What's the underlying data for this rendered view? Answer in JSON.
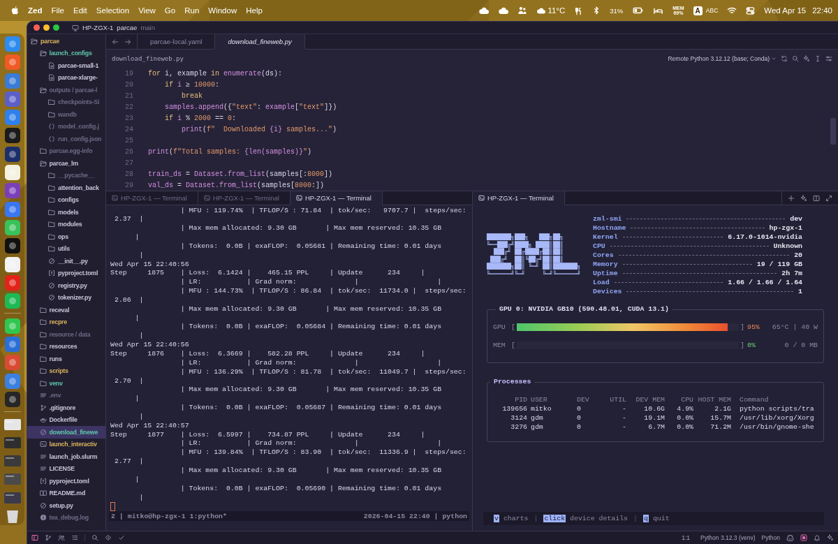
{
  "menubar": {
    "app": "Zed",
    "menus": [
      "File",
      "Edit",
      "Selection",
      "View",
      "Go",
      "Run",
      "Window",
      "Help"
    ],
    "weather": "11°C",
    "battery": "31%",
    "mem_label": "MEM",
    "mem_value": "69%",
    "input_badge": "A",
    "input_source": "ABC",
    "date": "Wed Apr 15",
    "time": "22:40"
  },
  "window": {
    "host": "HP-ZGX-1",
    "project": "parcae",
    "branch": "main"
  },
  "project_tree": [
    {
      "label": "parcae",
      "kind": "folder",
      "expanded": true,
      "color": "#d9b35c",
      "selected": false,
      "children": [
        {
          "label": "launch_configs",
          "kind": "folder",
          "expanded": true,
          "color": "#5ec7a9",
          "selected": false,
          "children": [
            {
              "label": "parcae-small-1",
              "kind": "config",
              "color": "#c8c5d8",
              "selected": false
            },
            {
              "label": "parcae-xlarge-",
              "kind": "config",
              "color": "#c8c5d8",
              "selected": false
            }
          ]
        },
        {
          "label": "outputs / parcae-l",
          "kind": "folder",
          "expanded": true,
          "color": "#6d6985",
          "selected": false,
          "children": [
            {
              "label": "checkpoints-Si",
              "kind": "folder",
              "expanded": false,
              "color": "#6d6985",
              "selected": false
            },
            {
              "label": "wandb",
              "kind": "folder",
              "expanded": false,
              "color": "#6d6985",
              "selected": false
            },
            {
              "label": "model_config.j",
              "kind": "json",
              "color": "#6d6985",
              "selected": false
            },
            {
              "label": "run_config.json",
              "kind": "json",
              "color": "#6d6985",
              "selected": false
            }
          ]
        },
        {
          "label": "parcae.egg-info",
          "kind": "folder",
          "expanded": false,
          "color": "#6d6985",
          "selected": false
        },
        {
          "label": "parcae_lm",
          "kind": "folder",
          "expanded": true,
          "color": "#c8c5d8",
          "selected": false,
          "children": [
            {
              "label": "__pycache__",
              "kind": "folder",
              "expanded": false,
              "color": "#6d6985",
              "selected": false
            },
            {
              "label": "attention_back",
              "kind": "folder",
              "expanded": false,
              "color": "#c8c5d8",
              "selected": false
            },
            {
              "label": "configs",
              "kind": "folder",
              "expanded": false,
              "color": "#c8c5d8",
              "selected": false
            },
            {
              "label": "models",
              "kind": "folder",
              "expanded": false,
              "color": "#c8c5d8",
              "selected": false
            },
            {
              "label": "modules",
              "kind": "folder",
              "expanded": false,
              "color": "#c8c5d8",
              "selected": false
            },
            {
              "label": "ops",
              "kind": "folder",
              "expanded": false,
              "color": "#c8c5d8",
              "selected": false
            },
            {
              "label": "utils",
              "kind": "folder",
              "expanded": false,
              "color": "#c8c5d8",
              "selected": false
            },
            {
              "label": "__init__.py",
              "kind": "python",
              "color": "#c8c5d8",
              "selected": false
            },
            {
              "label": "pyproject.toml",
              "kind": "toml",
              "color": "#c8c5d8",
              "selected": false
            },
            {
              "label": "registry.py",
              "kind": "python",
              "color": "#c8c5d8",
              "selected": false
            },
            {
              "label": "tokenizer.py",
              "kind": "python",
              "color": "#c8c5d8",
              "selected": false
            }
          ]
        },
        {
          "label": "receval",
          "kind": "folder",
          "expanded": false,
          "color": "#c8c5d8",
          "selected": false
        },
        {
          "label": "recpre",
          "kind": "folder",
          "expanded": false,
          "color": "#d9b35c",
          "selected": false
        },
        {
          "label": "resource / data",
          "kind": "folder",
          "expanded": false,
          "color": "#6d6985",
          "selected": false
        },
        {
          "label": "resources",
          "kind": "folder",
          "expanded": false,
          "color": "#c8c5d8",
          "selected": false
        },
        {
          "label": "runs",
          "kind": "folder",
          "expanded": false,
          "color": "#c8c5d8",
          "selected": false
        },
        {
          "label": "scripts",
          "kind": "folder",
          "expanded": false,
          "color": "#d9b35c",
          "selected": false
        },
        {
          "label": "venv",
          "kind": "folder",
          "expanded": false,
          "color": "#5ec7a9",
          "selected": false
        },
        {
          "label": ".env",
          "kind": "text",
          "color": "#6d6985",
          "selected": false
        },
        {
          "label": ".gitignore",
          "kind": "git",
          "color": "#c8c5d8",
          "selected": false
        },
        {
          "label": "Dockerfile",
          "kind": "docker",
          "color": "#c8c5d8",
          "selected": false
        },
        {
          "label": "download_finewe",
          "kind": "python",
          "color": "#5ec7a9",
          "selected": true
        },
        {
          "label": "launch_interactiv",
          "kind": "shell",
          "color": "#d9b35c",
          "selected": false
        },
        {
          "label": "launch_job.slurm",
          "kind": "text",
          "color": "#c8c5d8",
          "selected": false
        },
        {
          "label": "LICENSE",
          "kind": "text",
          "color": "#c8c5d8",
          "selected": false
        },
        {
          "label": "pyproject.toml",
          "kind": "toml",
          "color": "#c8c5d8",
          "selected": false
        },
        {
          "label": "README.md",
          "kind": "markdown",
          "color": "#c8c5d8",
          "selected": false
        },
        {
          "label": "setup.py",
          "kind": "python",
          "color": "#c8c5d8",
          "selected": false
        },
        {
          "label": "tea_debug.log",
          "kind": "log",
          "color": "#6d6985",
          "selected": false
        }
      ]
    }
  ],
  "editor": {
    "tabs": [
      {
        "label": "parcae-local.yaml",
        "selected": false,
        "preview": false
      },
      {
        "label": "download_fineweb.py",
        "selected": true,
        "preview": true
      }
    ],
    "breadcrumb": "download_fineweb.py",
    "interpreter": "Remote Python 3.12.12 (base; Conda)",
    "lines": [
      {
        "number": "19",
        "tokens": [
          {
            "kind": "kw",
            "text": "for"
          },
          {
            "kind": "plain",
            "text": " i, example "
          },
          {
            "kind": "kw",
            "text": "in"
          },
          {
            "kind": "fn",
            "text": " enumerate"
          },
          {
            "kind": "plain",
            "text": "(ds):"
          }
        ]
      },
      {
        "number": "20",
        "tokens": [
          {
            "kind": "kw",
            "text": "    if"
          },
          {
            "kind": "var",
            "text": " i"
          },
          {
            "kind": "plain",
            "text": " ≥ "
          },
          {
            "kind": "num",
            "text": "10000"
          },
          {
            "kind": "plain",
            "text": ":"
          }
        ]
      },
      {
        "number": "21",
        "tokens": [
          {
            "kind": "kw",
            "text": "        break"
          }
        ]
      },
      {
        "number": "22",
        "tokens": [
          {
            "kind": "fn",
            "text": "    samples.append"
          },
          {
            "kind": "plain",
            "text": "({"
          },
          {
            "kind": "str",
            "text": "\"text\""
          },
          {
            "kind": "plain",
            "text": ": "
          },
          {
            "kind": "fn",
            "text": "example"
          },
          {
            "kind": "plain",
            "text": "["
          },
          {
            "kind": "str",
            "text": "\"text\""
          },
          {
            "kind": "plain",
            "text": "]})"
          }
        ]
      },
      {
        "number": "23",
        "tokens": [
          {
            "kind": "kw",
            "text": "    if"
          },
          {
            "kind": "var",
            "text": " i"
          },
          {
            "kind": "plain",
            "text": " % "
          },
          {
            "kind": "num",
            "text": "2000"
          },
          {
            "kind": "plain",
            "text": " == "
          },
          {
            "kind": "num",
            "text": "0"
          },
          {
            "kind": "plain",
            "text": ":"
          }
        ]
      },
      {
        "number": "24",
        "tokens": [
          {
            "kind": "fn",
            "text": "        print"
          },
          {
            "kind": "plain",
            "text": "("
          },
          {
            "kind": "str",
            "text": "f\"  Downloaded "
          },
          {
            "kind": "var",
            "text": "{i}"
          },
          {
            "kind": "str",
            "text": " samples...\""
          },
          {
            "kind": "plain",
            "text": ")"
          }
        ]
      },
      {
        "number": "25"
      },
      {
        "number": "26",
        "tokens": [
          {
            "kind": "fn",
            "text": "print"
          },
          {
            "kind": "plain",
            "text": "("
          },
          {
            "kind": "str",
            "text": "f\"Total samples: "
          },
          {
            "kind": "var",
            "text": "{len(samples)}"
          },
          {
            "kind": "str",
            "text": "\""
          },
          {
            "kind": "plain",
            "text": ")"
          }
        ]
      },
      {
        "number": "27"
      },
      {
        "number": "28",
        "tokens": [
          {
            "kind": "var",
            "text": "train_ds"
          },
          {
            "kind": "plain",
            "text": " = "
          },
          {
            "kind": "fn",
            "text": "Dataset.from_list"
          },
          {
            "kind": "plain",
            "text": "(samples[:"
          },
          {
            "kind": "num",
            "text": "8000"
          },
          {
            "kind": "plain",
            "text": "])"
          }
        ]
      },
      {
        "number": "29",
        "tokens": [
          {
            "kind": "var",
            "text": "val_ds"
          },
          {
            "kind": "plain",
            "text": " = "
          },
          {
            "kind": "fn",
            "text": "Dataset.from_list"
          },
          {
            "kind": "plain",
            "text": "(samples["
          },
          {
            "kind": "num",
            "text": "8000"
          },
          {
            "kind": "plain",
            "text": ":])"
          }
        ]
      }
    ]
  },
  "terminals": {
    "left": {
      "tabs": [
        {
          "label": "HP-ZGX-1 — Terminal",
          "selected": false
        },
        {
          "label": "HP-ZGX-1 — Terminal",
          "selected": false
        },
        {
          "label": "HP-ZGX-1 — Terminal",
          "selected": true
        }
      ],
      "lines": [
        "                 | MFU : 119.74%  | TFLOP/S : 71.84  | tok/sec:   9707.7 |  steps/sec:",
        " 2.37  |",
        "                 | Max mem allocated: 9.30 GB       | Max mem reserved: 10.35 GB",
        "      |",
        "                 | Tokens:  0.0B | exaFLOP:  0.05681 | Remaining time: 0.01 days",
        "       |",
        "Wed Apr 15 22:40:56",
        "Step     1875    | Loss:  6.1424 |    465.15 PPL     | Update      234     |",
        "                 | LR:           | Grad norm:              |                   |",
        "                 | MFU : 144.73%  | TFLOP/S : 86.84  | tok/sec:  11734.0 |  steps/sec:",
        " 2.86  |",
        "                 | Max mem allocated: 9.30 GB       | Max mem reserved: 10.35 GB",
        "      |",
        "                 | Tokens:  0.0B | exaFLOP:  0.05684 | Remaining time: 0.01 days",
        "       |",
        "Wed Apr 15 22:40:56",
        "Step     1876    | Loss:  6.3669 |    582.28 PPL     | Update      234     |",
        "                 | LR:           | Grad norm:              |                   |",
        "                 | MFU : 136.29%  | TFLOP/S : 81.78  | tok/sec:  11049.7 |  steps/sec:",
        " 2.70  |",
        "                 | Max mem allocated: 9.30 GB       | Max mem reserved: 10.35 GB",
        "      |",
        "                 | Tokens:  0.0B | exaFLOP:  0.05687 | Remaining time: 0.01 days",
        "       |",
        "Wed Apr 15 22:40:57",
        "Step     1877    | Loss:  6.5997 |    734.87 PPL     | Update      234     |",
        "                 | LR:           | Grad norm:              |                   |",
        "                 | MFU : 139.84%  | TFLOP/S : 83.90  | tok/sec:  11336.9 |  steps/sec:",
        " 2.77  |",
        "                 | Max mem allocated: 9.30 GB       | Max mem reserved: 10.35 GB",
        "      |",
        "                 | Tokens:  0.0B | exaFLOP:  0.05690 | Remaining time: 0.01 days",
        "       |"
      ],
      "status_left": "2 | mitko@hp-zgx-1 1:python*",
      "status_right": "2026-04-15 22:40 | python"
    },
    "right": {
      "tab": {
        "label": "HP-ZGX-1 — Terminal",
        "selected": true
      },
      "logo": [
        "███████╗███╗   ███╗██╗",
        "╚══███╔╝████╗ ████║██║",
        "  ███╔╝ ██╔████╔██║██║",
        " ███╔╝  ██║╚██╔╝██║██║",
        "███████╗██║ ╚═╝ ██║███████╗",
        "╚══════╝╚═╝     ╚═╝╚══════╝"
      ],
      "info": [
        {
          "key": "zml-smi",
          "value": "dev"
        },
        {
          "key": "Hostname",
          "value": "hp-zgx-1"
        },
        {
          "key": "Kernel",
          "value": "6.17.0-1014-nvidia"
        },
        {
          "key": "CPU",
          "value": "Unknown"
        },
        {
          "key": "Cores",
          "value": "20"
        },
        {
          "key": "Memory",
          "value": "19 / 119 GB"
        },
        {
          "key": "Uptime",
          "value": "2h 7m"
        },
        {
          "key": "Load",
          "value": "1.66 / 1.66 / 1.64"
        },
        {
          "key": "Devices",
          "value": "1"
        }
      ],
      "gpu": {
        "title": "GPU 0: NVIDIA GB10 (590.48.01, CUDA 13.1)",
        "meters": [
          {
            "label": "GPU",
            "open": "[",
            "close": "]",
            "level": 0.95,
            "percent": "95%",
            "reading": "65°C | 40 W"
          },
          {
            "label": "MEM",
            "open": "[",
            "close": "]",
            "level": 0,
            "percent": "0%",
            "reading": "0 / 0 MB"
          }
        ]
      },
      "processes": {
        "title": "Processes",
        "columns": [
          "PID",
          "USER",
          "DEV",
          "UTIL",
          "DEV MEM",
          "CPU",
          "HOST MEM",
          "Command"
        ],
        "rows": [
          [
            "139656",
            "mitko",
            "0",
            "-",
            "10.6G",
            "4.9%",
            "2.1G",
            "python scripts/tra"
          ],
          [
            "3124",
            "gdm",
            "0",
            "-",
            "19.1M",
            "0.0%",
            "15.7M",
            "/usr/lib/xorg/Xorg"
          ],
          [
            "3276",
            "gdm",
            "0",
            "-",
            "6.7M",
            "0.0%",
            "71.2M",
            "/usr/bin/gnome-she"
          ]
        ]
      },
      "footer": [
        {
          "kind": "key",
          "text": "v"
        },
        {
          "kind": "label",
          "text": "charts"
        },
        {
          "kind": "sep",
          "text": "|"
        },
        {
          "kind": "key",
          "text": "click"
        },
        {
          "kind": "label",
          "text": "device details"
        },
        {
          "kind": "sep",
          "text": "|"
        },
        {
          "kind": "key",
          "text": "q"
        },
        {
          "kind": "label",
          "text": "quit"
        }
      ]
    }
  },
  "status_bar": {
    "position": "1:1",
    "environment": "Python 3.12.3 (venv)",
    "language": "Python"
  }
}
